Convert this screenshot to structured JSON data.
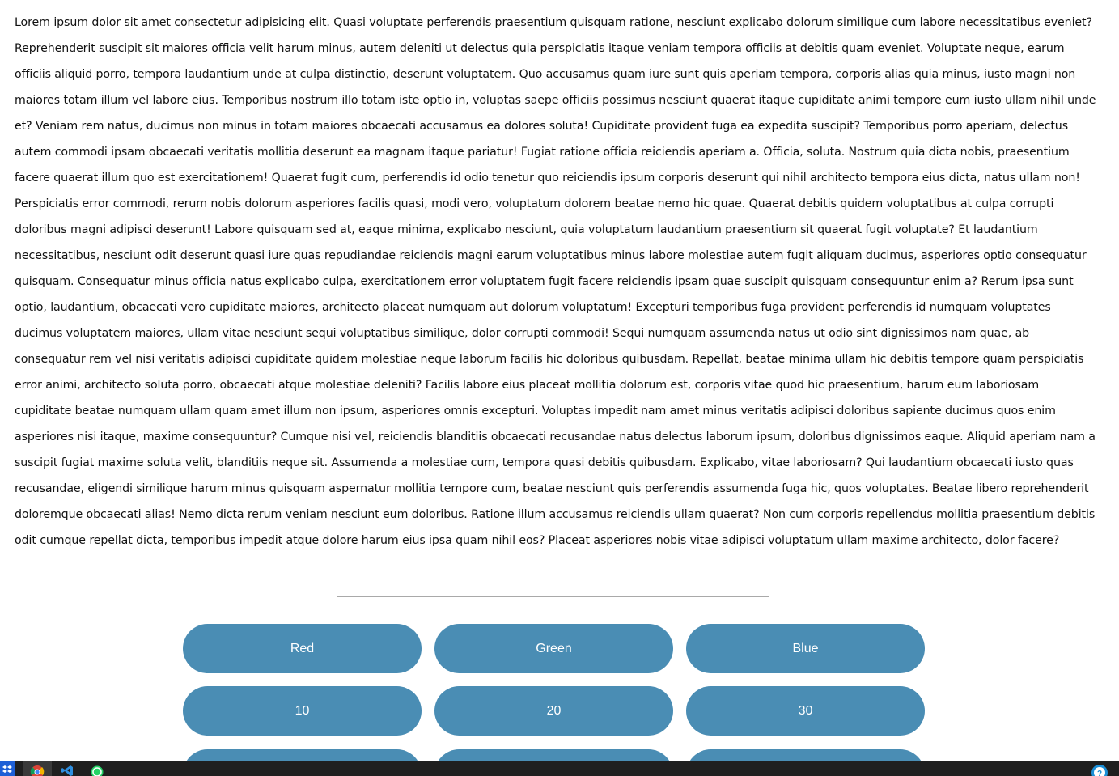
{
  "article": {
    "text": "Lorem ipsum dolor sit amet consectetur adipisicing elit. Quasi voluptate perferendis praesentium quisquam ratione, nesciunt explicabo dolorum similique cum labore necessitatibus eveniet? Reprehenderit suscipit sit maiores officia velit harum minus, autem deleniti ut delectus quia perspiciatis itaque veniam tempora officiis at debitis quam eveniet. Voluptate neque, earum officiis aliquid porro, tempora laudantium unde at culpa distinctio, deserunt voluptatem. Quo accusamus quam iure sunt quis aperiam tempora, corporis alias quia minus, iusto magni non maiores totam illum vel labore eius. Temporibus nostrum illo totam iste optio in, voluptas saepe officiis possimus nesciunt quaerat itaque cupiditate animi tempore eum iusto ullam nihil unde et? Veniam rem natus, ducimus non minus in totam maiores obcaecati accusamus ea dolores soluta! Cupiditate provident fuga ea expedita suscipit? Temporibus porro aperiam, delectus autem commodi ipsam obcaecati veritatis mollitia deserunt ea magnam itaque pariatur! Fugiat ratione officia reiciendis aperiam a. Officia, soluta. Nostrum quia dicta nobis, praesentium facere quaerat illum quo est exercitationem! Quaerat fugit cum, perferendis id odio tenetur quo reiciendis ipsum corporis deserunt qui nihil architecto tempora eius dicta, natus ullam non! Perspiciatis error commodi, rerum nobis dolorum asperiores facilis quasi, modi vero, voluptatum dolorem beatae nemo hic quae. Quaerat debitis quidem voluptatibus at culpa corrupti doloribus magni adipisci deserunt! Labore quisquam sed at, eaque minima, explicabo nesciunt, quia voluptatum laudantium praesentium sit quaerat fugit voluptate? Et laudantium necessitatibus, nesciunt odit deserunt quasi iure quas repudiandae reiciendis magni earum voluptatibus minus labore molestiae autem fugit aliquam ducimus, asperiores optio consequatur quisquam. Consequatur minus officia natus explicabo culpa, exercitationem error voluptatem fugit facere reiciendis ipsam quae suscipit quisquam consequuntur enim a? Rerum ipsa sunt optio, laudantium, obcaecati vero cupiditate maiores, architecto placeat numquam aut dolorum voluptatum! Excepturi temporibus fuga provident perferendis id numquam voluptates ducimus voluptatem maiores, ullam vitae nesciunt sequi voluptatibus similique, dolor corrupti commodi! Sequi numquam assumenda natus ut odio sint dignissimos nam quae, ab consequatur rem vel nisi veritatis adipisci cupiditate quidem molestiae neque laborum facilis hic doloribus quibusdam. Repellat, beatae minima ullam hic debitis tempore quam perspiciatis error animi, architecto soluta porro, obcaecati atque molestiae deleniti? Facilis labore eius placeat mollitia dolorum est, corporis vitae quod hic praesentium, harum eum laboriosam cupiditate beatae numquam ullam quam amet illum non ipsum, asperiores omnis excepturi. Voluptas impedit nam amet minus veritatis adipisci doloribus sapiente ducimus quos enim asperiores nisi itaque, maxime consequuntur? Cumque nisi vel, reiciendis blanditiis obcaecati recusandae natus delectus laborum ipsum, doloribus dignissimos eaque. Aliquid aperiam nam a suscipit fugiat maxime soluta velit, blanditiis neque sit. Assumenda a molestiae cum, tempora quasi debitis quibusdam. Explicabo, vitae laboriosam? Qui laudantium obcaecati iusto quas recusandae, eligendi similique harum minus quisquam aspernatur mollitia tempore cum, beatae nesciunt quis perferendis assumenda fuga hic, quos voluptates. Beatae libero reprehenderit doloremque obcaecati alias! Nemo dicta rerum veniam nesciunt eum doloribus. Ratione illum accusamus reiciendis ullam quaerat? Non cum corporis repellendus mollitia praesentium debitis odit cumque repellat dicta, temporibus impedit atque dolore harum eius ipsa quam nihil eos? Placeat asperiores nobis vitae adipisci voluptatum ullam maxime architecto, dolor facere?"
  },
  "buttons": {
    "color_red": "Red",
    "color_green": "Green",
    "color_blue": "Blue",
    "size_10": "10",
    "size_20": "20",
    "size_30": "30",
    "row3_a": "",
    "row3_b": "",
    "row3_c": ""
  },
  "colors": {
    "button_bg": "#4a8db4",
    "button_text": "#ffffff",
    "text": "#111111",
    "divider": "#a9a9a9",
    "taskbar": "#1f1f1f"
  },
  "taskbar": {
    "icons": [
      "dropbox-icon",
      "chrome-icon",
      "vscode-icon",
      "whatsapp-icon",
      "help-icon"
    ]
  }
}
